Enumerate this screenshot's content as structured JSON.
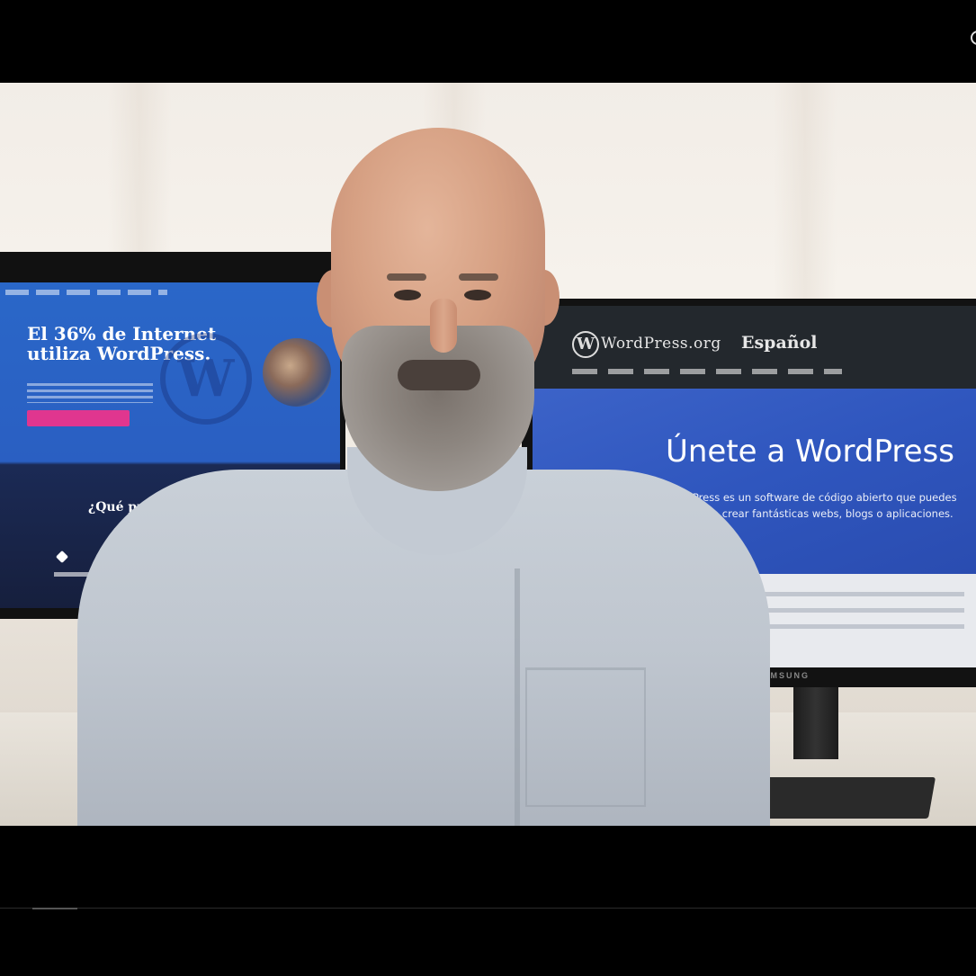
{
  "video": {
    "left_monitor": {
      "headline": "El 36% de Internet utiliza WordPress.",
      "section_heading": "¿Qué puedes hac"
    },
    "right_monitor": {
      "brand": "WordPress.org",
      "language": "Español",
      "hero_title": "Únete a WordPress",
      "hero_description": "WordPress es un software de código abierto que puedes usar para crear fantásticas webs, blogs o aplicaciones.",
      "monitor_brand": "SAMSUNG"
    },
    "watermark_icon": "building-icon",
    "colors": {
      "wp_blue": "#2f56be",
      "wp_dark": "#23282d",
      "accent_pink": "#e0368f",
      "watermark_orange": "#f07a2a"
    }
  }
}
